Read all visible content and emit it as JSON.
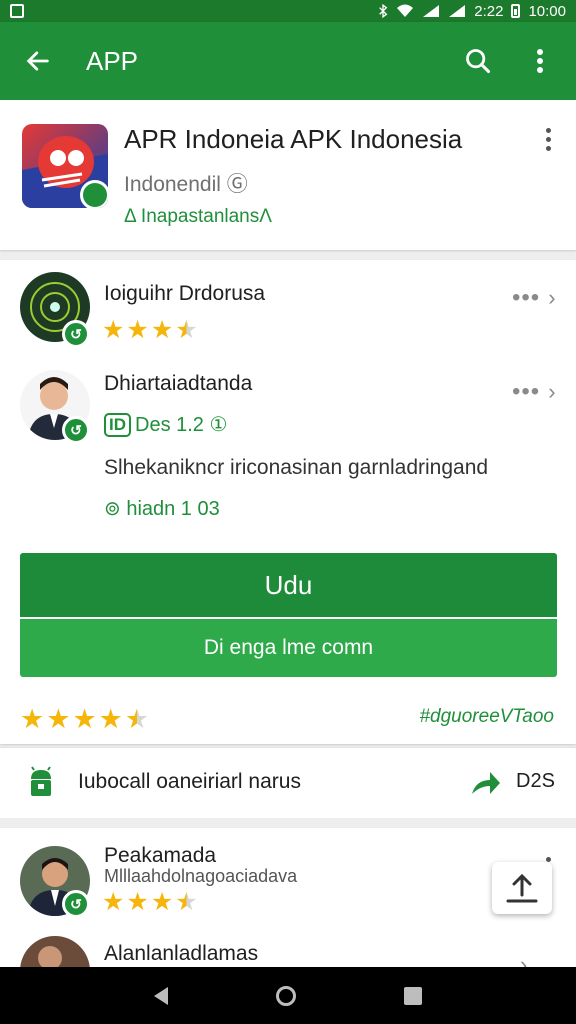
{
  "status_bar": {
    "time": "10:00",
    "battery_text": "2:22"
  },
  "app_bar": {
    "title": "APP"
  },
  "app_header": {
    "name": "APR Indoneia APK Indonesia",
    "developer": "Indonendil Ⓖ",
    "installs": "Δ InapastanlansΛ"
  },
  "reviews": [
    {
      "name": "Ioiguihr Drdorusa",
      "rating": 3.5
    },
    {
      "name": "Dhiartaiadtanda",
      "version_box": "ID",
      "version_text": "Des 1.2 ①",
      "text": "Slhekanikncr iriconasinan garnladringand",
      "helpful": "⊚ hiadn 1 03"
    }
  ],
  "buttons": {
    "install": "Udu",
    "secondary": "Di enga lme comn"
  },
  "rating_summary": {
    "rating": 4.5,
    "tag": "#dguoreeVTaoo"
  },
  "info_row": {
    "label": "Iubocall oaneiriarl narus",
    "count": "D2S"
  },
  "bottom_reviews": [
    {
      "name": "Peakamada",
      "subtitle": "Mlllaahdolnagoaciadava",
      "rating": 3.5
    },
    {
      "name": "Alanlanladlamas"
    }
  ],
  "colors": {
    "primary": "#1f8f3a",
    "status": "#1c7a2c",
    "button_secondary": "#2eaa4a",
    "star": "#f5b50a"
  }
}
